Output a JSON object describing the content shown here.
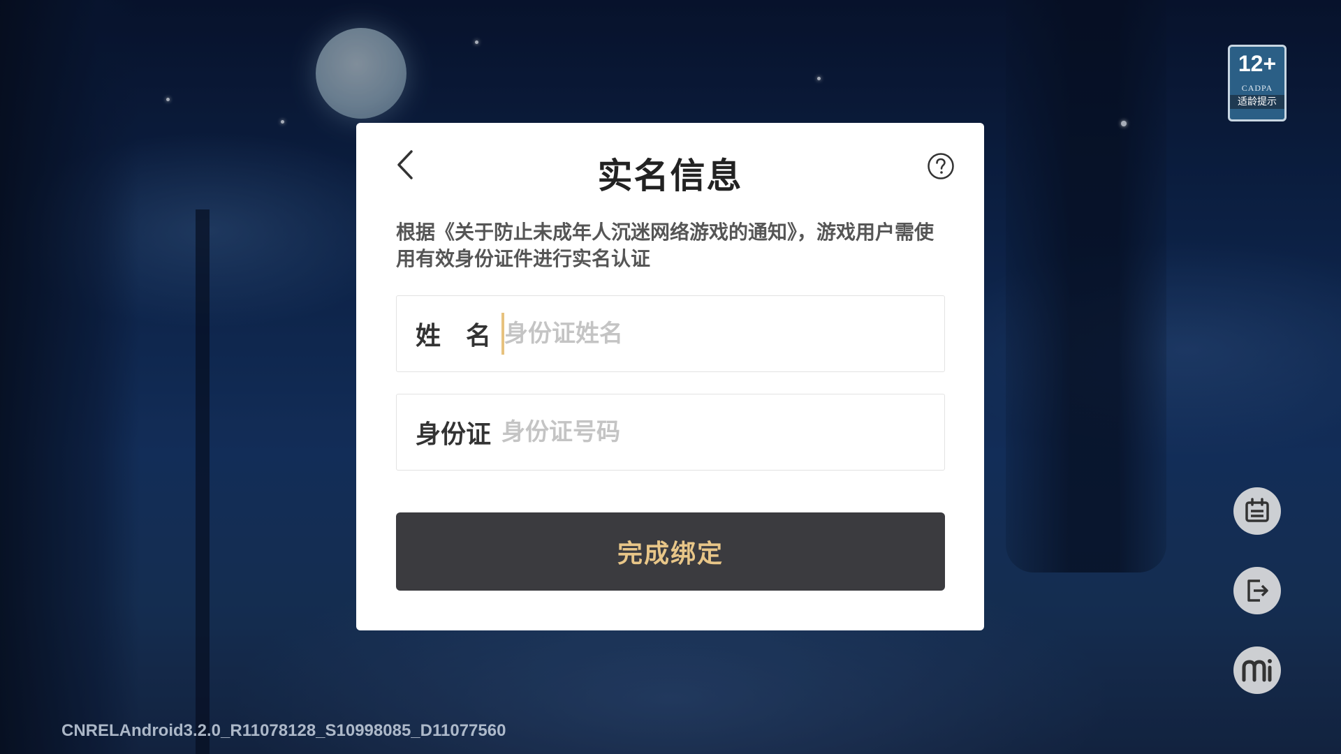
{
  "dialog": {
    "title": "实名信息",
    "notice": "根据《关于防止未成年人沉迷网络游戏的通知》，游戏用户需使用有效身份证件进行实名认证",
    "name_field": {
      "label": "姓　名",
      "placeholder": "身份证姓名",
      "value": ""
    },
    "id_field": {
      "label": "身份证",
      "placeholder": "身份证号码",
      "value": ""
    },
    "submit_label": "完成绑定",
    "back_icon": "chevron-left-icon",
    "help_icon": "question-circle-icon"
  },
  "age_rating": {
    "age": "12+",
    "org": "CADPA",
    "tip": "适龄提示"
  },
  "side_buttons": [
    {
      "icon": "announcement-icon"
    },
    {
      "icon": "logout-icon"
    },
    {
      "icon": "mi-logo-icon"
    }
  ],
  "version_text": "CNRELAndroid3.2.0_R11078128_S10998085_D11077560",
  "colors": {
    "button_bg": "#3b3b3f",
    "button_text": "#e8c688",
    "cursor": "#e7c27e"
  }
}
